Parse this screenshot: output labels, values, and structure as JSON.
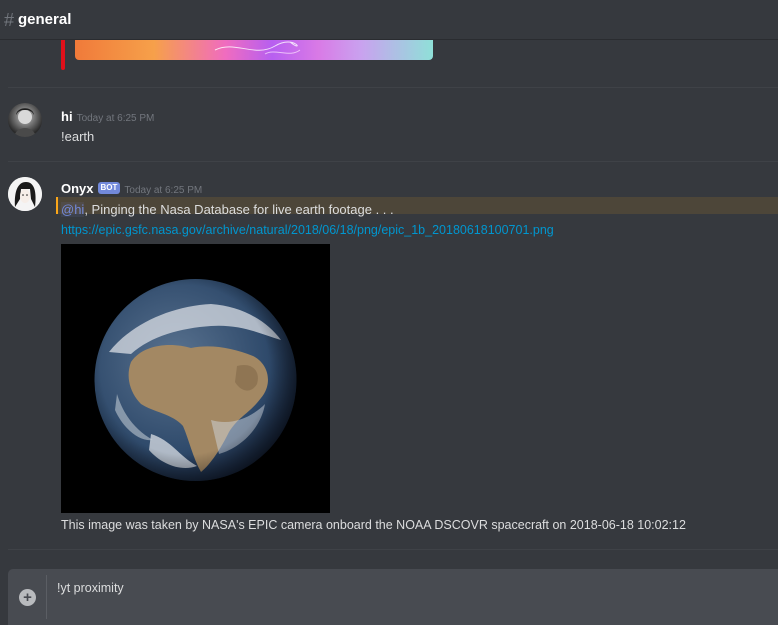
{
  "channel": {
    "name": "general"
  },
  "messages": [
    {
      "author": "hi",
      "timestamp": "Today at 6:25 PM",
      "content": "!earth"
    },
    {
      "author": "Onyx",
      "badge": "BOT",
      "timestamp": "Today at 6:25 PM",
      "mention": "@hi",
      "content": ", Pinging the Nasa Database for live earth footage . . .",
      "link": "https://epic.gsfc.nasa.gov/archive/natural/2018/06/18/png/epic_1b_20180618100701.png",
      "caption": "This image was taken by NASA's EPIC camera onboard the NOAA DSCOVR spacecraft on 2018-06-18 10:02:12"
    }
  ],
  "composer": {
    "value": "!yt proximity"
  },
  "colors": {
    "accent": "#7289da",
    "link": "#0096cf",
    "mention_highlight": "#faa61a",
    "embed_bar": "#e0101a"
  }
}
